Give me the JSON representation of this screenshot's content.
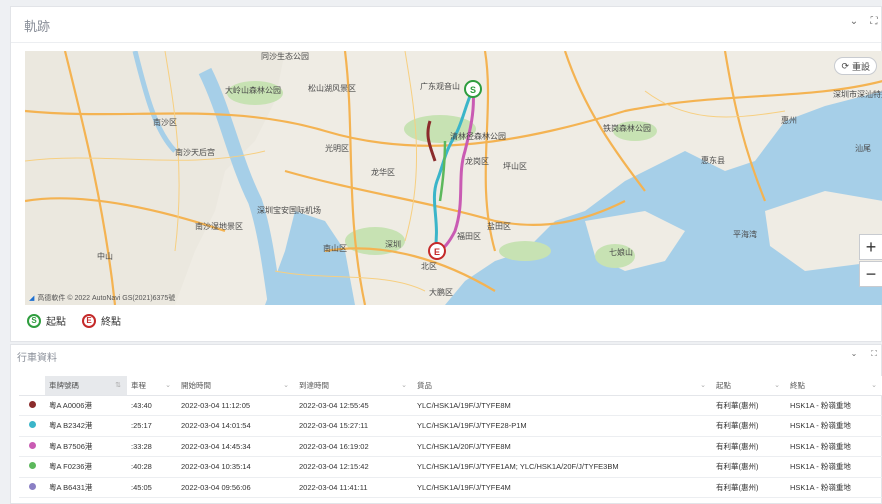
{
  "trajectory": {
    "title": "軌跡",
    "reset_label": "重設",
    "zoom_in": "+",
    "zoom_out": "−",
    "attribution": "高德軟件 © 2022 AutoNavi GS(2021)6375號",
    "legend_start": "起點",
    "legend_end": "終點",
    "start_marker": "S",
    "end_marker": "E",
    "map_labels": [
      "同沙生态公园",
      "南沙区",
      "广东观音山",
      "南沙天后宫",
      "南沙湿地景区",
      "中山",
      "深圳宝安国际机场",
      "大岭山森林公园",
      "松山湖风景区",
      "清林径森林公园",
      "龙岗区",
      "坪山区",
      "龙华区",
      "光明区",
      "南山区",
      "深圳",
      "福田区",
      "盐田区",
      "大鹏区",
      "北区",
      "惠东县",
      "深圳市深汕特别合作区",
      "七娘山",
      "平海湾",
      "铁岗森林公园",
      "惠州",
      "汕尾"
    ]
  },
  "trip_table": {
    "title": "行車資料",
    "columns": [
      "車牌號碼",
      "車程",
      "開始時間",
      "到達時間",
      "貨品",
      "起點",
      "終點"
    ],
    "rows": [
      {
        "color": "#8b2b2b",
        "plate": "粵A A0006港",
        "duration": ":43:40",
        "start": "2022-03-04 11:12:05",
        "end": "2022-03-04 12:55:45",
        "goods": "YLC/HSK1A/19F/J/TYFE8M",
        "origin": "有利華(惠州)",
        "dest": "HSK1A - 粉嶺重地"
      },
      {
        "color": "#3bb5c9",
        "plate": "粵A B2342港",
        "duration": ":25:17",
        "start": "2022-03-04 14:01:54",
        "end": "2022-03-04 15:27:11",
        "goods": "YLC/HSK1A/19F/J/TYFE28-P1M",
        "origin": "有利華(惠州)",
        "dest": "HSK1A - 粉嶺重地"
      },
      {
        "color": "#c95bb3",
        "plate": "粵A B7506港",
        "duration": ":33:28",
        "start": "2022-03-04 14:45:34",
        "end": "2022-03-04 16:19:02",
        "goods": "YLC/HSK1A/20F/J/TYFE8M",
        "origin": "有利華(惠州)",
        "dest": "HSK1A - 粉嶺重地"
      },
      {
        "color": "#5cb85c",
        "plate": "粵A F0236港",
        "duration": ":40:28",
        "start": "2022-03-04 10:35:14",
        "end": "2022-03-04 12:15:42",
        "goods": "YLC/HSK1A/19F/J/TYFE1AM; YLC/HSK1A/20F/J/TYFE3BM",
        "origin": "有利華(惠州)",
        "dest": "HSK1A - 粉嶺重地"
      },
      {
        "color": "#8a7fc4",
        "plate": "粵A B6431港",
        "duration": ":45:05",
        "start": "2022-03-04 09:56:06",
        "end": "2022-03-04 11:41:11",
        "goods": "YLC/HSK1A/19F/J/TYFE4M",
        "origin": "有利華(惠州)",
        "dest": "HSK1A - 粉嶺重地"
      }
    ]
  }
}
